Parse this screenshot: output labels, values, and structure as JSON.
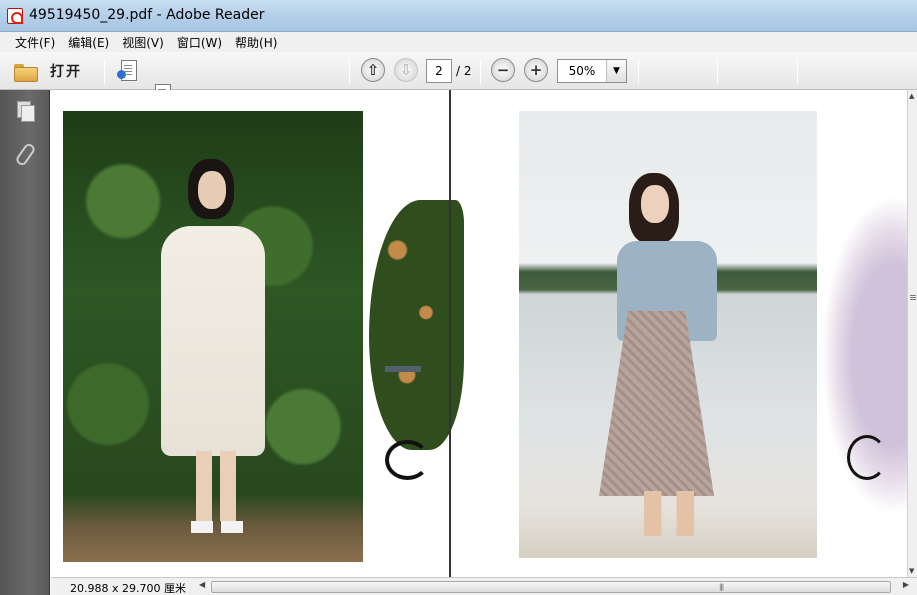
{
  "window": {
    "title": "49519450_29.pdf - Adobe Reader",
    "icon": "adobe-pdf-icon"
  },
  "menu": {
    "items": [
      "文件(F)",
      "编辑(E)",
      "视图(V)",
      "窗口(W)",
      "帮助(H)"
    ]
  },
  "toolbar": {
    "open_label": "打开",
    "page_current": "2",
    "page_total": "/ 2",
    "zoom": "50%",
    "icons": [
      "folder-icon",
      "create-pdf-icon",
      "export-pdf-icon",
      "sign-icon",
      "upload-icon",
      "save-icon",
      "print-icon",
      "email-icon",
      "page-up-icon",
      "page-down-icon",
      "zoom-out-icon",
      "zoom-in-icon",
      "fit-page-icon",
      "fit-width-icon",
      "comment-icon",
      "highlight-text-icon",
      "fullscreen-icon"
    ]
  },
  "navpane": {
    "icons": [
      "pages-icon",
      "attachment-icon"
    ]
  },
  "status": {
    "page_size": "20.988 x 29.700 厘米"
  }
}
